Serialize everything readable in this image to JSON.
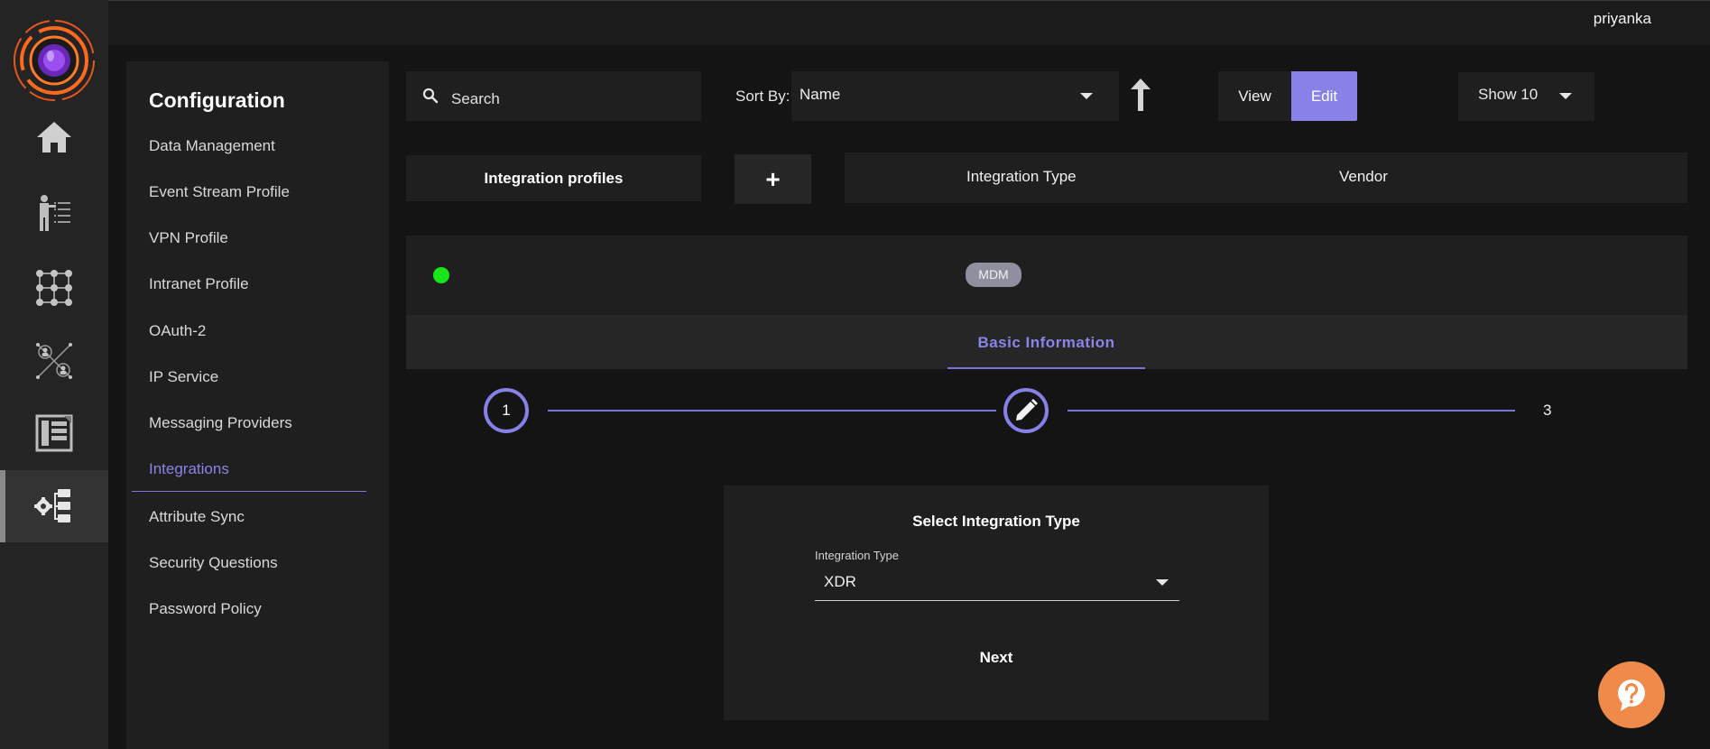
{
  "header": {
    "username": "priyanka"
  },
  "sidebar": {
    "title": "Configuration",
    "items": [
      {
        "label": "Data Management"
      },
      {
        "label": "Event Stream Profile"
      },
      {
        "label": "VPN Profile"
      },
      {
        "label": "Intranet Profile"
      },
      {
        "label": "OAuth-2"
      },
      {
        "label": "IP Service"
      },
      {
        "label": "Messaging Providers"
      },
      {
        "label": "Integrations",
        "active": true
      },
      {
        "label": "Attribute Sync"
      },
      {
        "label": "Security Questions"
      },
      {
        "label": "Password Policy"
      }
    ]
  },
  "toolbar": {
    "search_label": "Search",
    "sort_by_label": "Sort By:",
    "sort_value": "Name",
    "view_label": "View",
    "edit_label": "Edit",
    "show_value": "Show 10"
  },
  "profiles": {
    "header": "Integration profiles",
    "add_label": "+",
    "col_integration_type": "Integration Type",
    "col_vendor": "Vendor"
  },
  "profile_row": {
    "badge": "MDM",
    "status_color": "#19e619"
  },
  "tabs": {
    "basic_information": "Basic Information"
  },
  "stepper": {
    "step1": "1",
    "step3": "3"
  },
  "integration_form": {
    "title": "Select Integration Type",
    "field_label": "Integration Type",
    "field_value": "XDR",
    "next_label": "Next"
  },
  "colors": {
    "accent": "#8882e8",
    "help": "#f08a4b"
  }
}
